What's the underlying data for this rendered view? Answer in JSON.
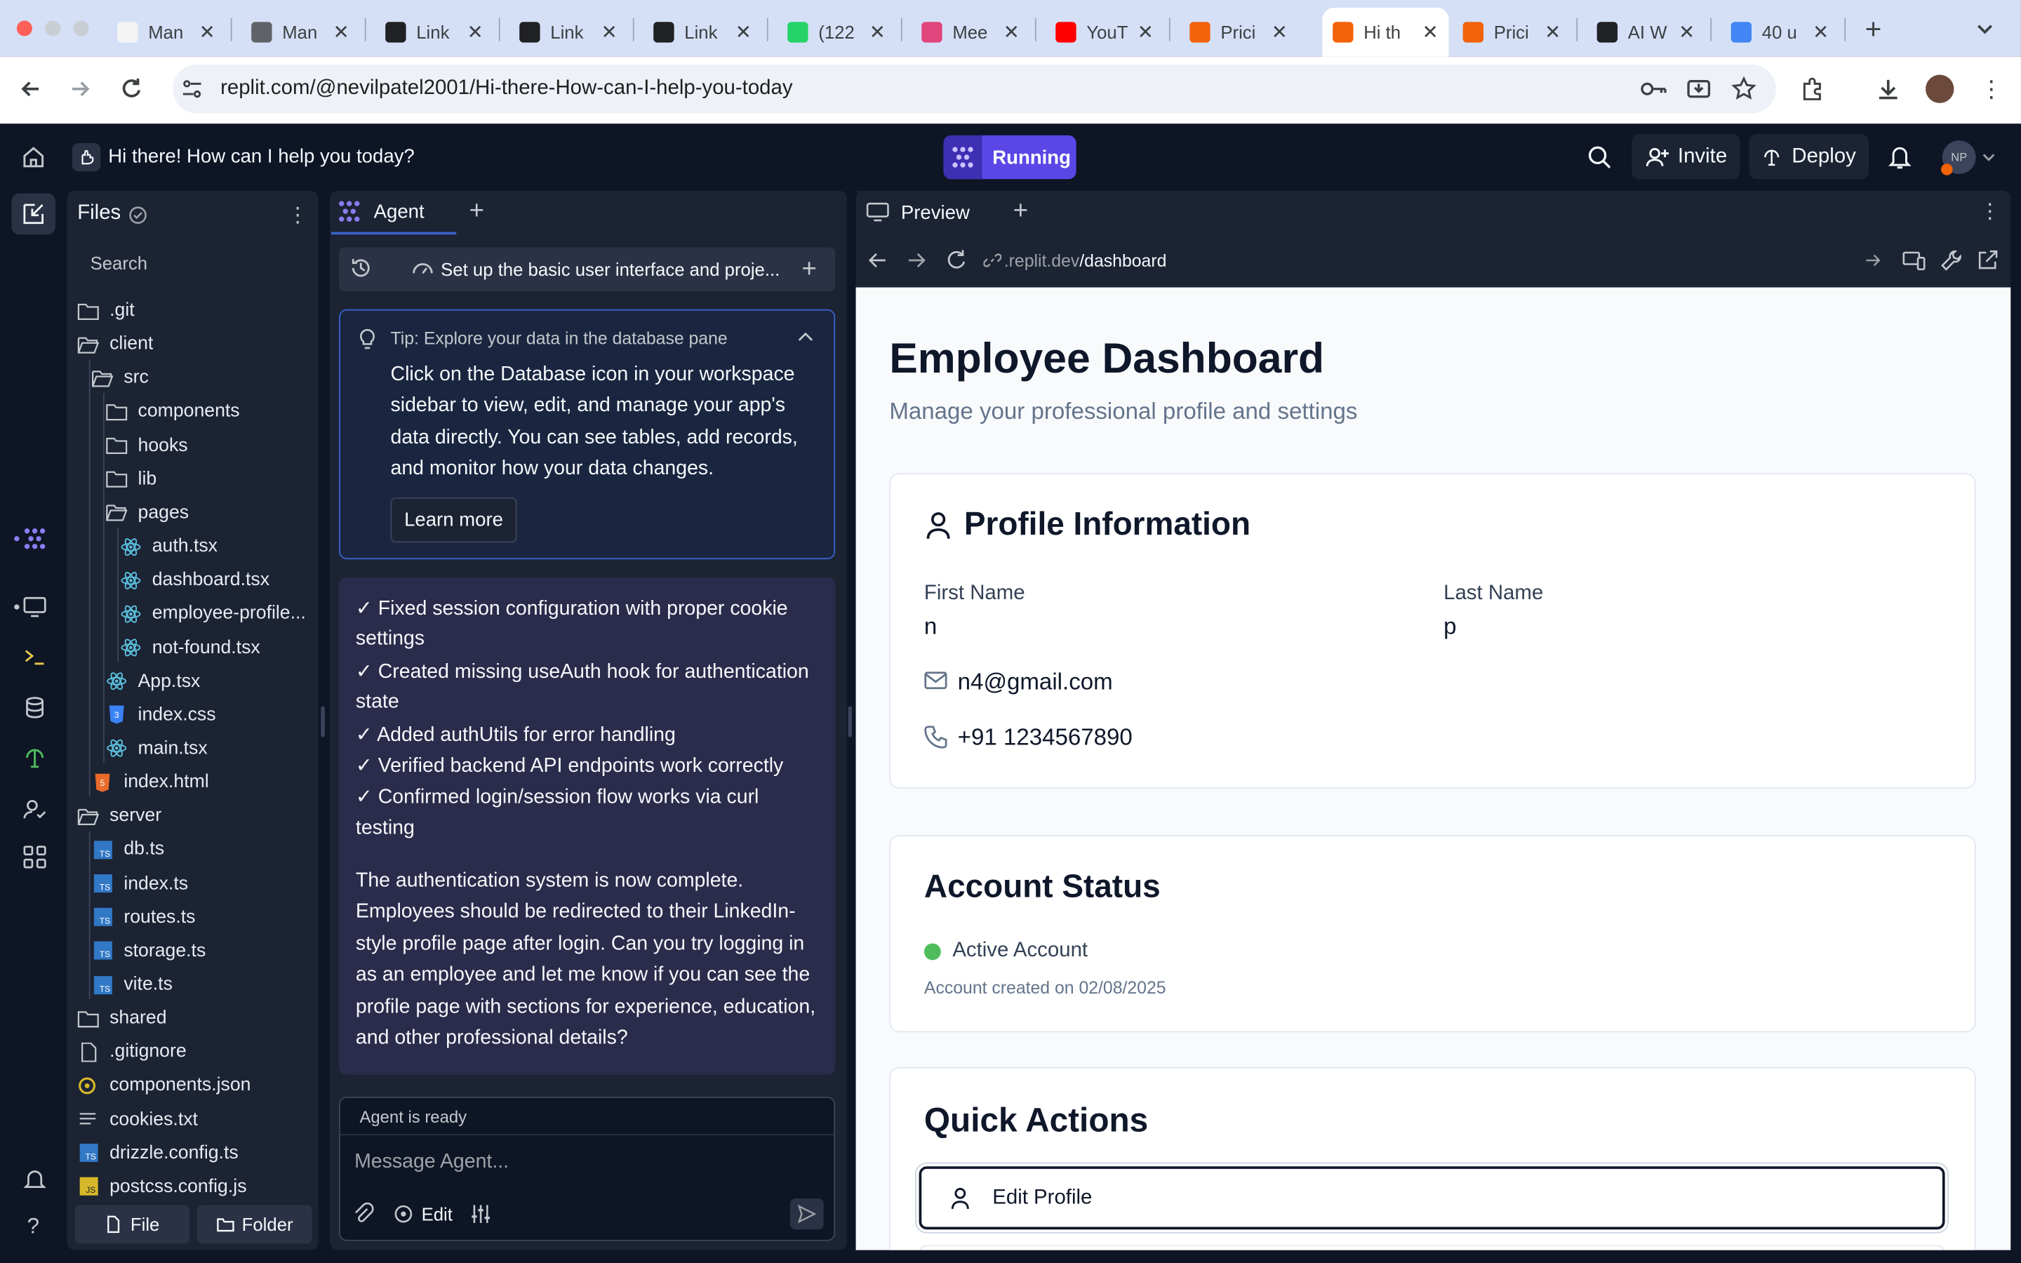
{
  "browser": {
    "tabs": [
      {
        "label": "Man",
        "color": "#f4f4f4"
      },
      {
        "label": "Man",
        "color": "#5f6368"
      },
      {
        "label": "Link",
        "color": "#202124"
      },
      {
        "label": "Link",
        "color": "#202124"
      },
      {
        "label": "Link",
        "color": "#202124"
      },
      {
        "label": "(122",
        "color": "#25d366"
      },
      {
        "label": "Mee",
        "color": "#e0457b"
      },
      {
        "label": "YouT",
        "color": "#ff0000"
      },
      {
        "label": "Prici",
        "color": "#f26207"
      },
      {
        "label": "Hi th",
        "color": "#f26207",
        "active": true
      },
      {
        "label": "Prici",
        "color": "#f26207"
      },
      {
        "label": "AI W",
        "color": "#202124"
      },
      {
        "label": "40 u",
        "color": "#4285f4"
      }
    ],
    "url": "replit.com/@nevilpatel2001/Hi-there-How-can-I-help-you-today"
  },
  "header": {
    "project_title": "Hi there! How can I help you today?",
    "run_status": "Running",
    "invite_label": "Invite",
    "deploy_label": "Deploy",
    "avatar_initials": "NP"
  },
  "files": {
    "title": "Files",
    "search_placeholder": "Search",
    "items": [
      {
        "name": ".git",
        "type": "folder"
      },
      {
        "name": "client",
        "type": "folder-open"
      },
      {
        "name": "src",
        "type": "folder-open"
      },
      {
        "name": "components",
        "type": "folder"
      },
      {
        "name": "hooks",
        "type": "folder"
      },
      {
        "name": "lib",
        "type": "folder"
      },
      {
        "name": "pages",
        "type": "folder-open"
      },
      {
        "name": "auth.tsx",
        "type": "react"
      },
      {
        "name": "dashboard.tsx",
        "type": "react"
      },
      {
        "name": "employee-profile...",
        "type": "react"
      },
      {
        "name": "not-found.tsx",
        "type": "react"
      },
      {
        "name": "App.tsx",
        "type": "react"
      },
      {
        "name": "index.css",
        "type": "css"
      },
      {
        "name": "main.tsx",
        "type": "react"
      },
      {
        "name": "index.html",
        "type": "html"
      },
      {
        "name": "server",
        "type": "folder-open"
      },
      {
        "name": "db.ts",
        "type": "ts"
      },
      {
        "name": "index.ts",
        "type": "ts"
      },
      {
        "name": "routes.ts",
        "type": "ts"
      },
      {
        "name": "storage.ts",
        "type": "ts"
      },
      {
        "name": "vite.ts",
        "type": "ts"
      },
      {
        "name": "shared",
        "type": "folder"
      },
      {
        "name": ".gitignore",
        "type": "file"
      },
      {
        "name": "components.json",
        "type": "json"
      },
      {
        "name": "cookies.txt",
        "type": "text"
      },
      {
        "name": "drizzle.config.ts",
        "type": "ts"
      },
      {
        "name": "postcss.config.js",
        "type": "js"
      }
    ],
    "new_file_label": "File",
    "new_folder_label": "Folder"
  },
  "agent": {
    "tab_label": "Agent",
    "task_title": "Set up the basic user interface and proje...",
    "tip_title": "Tip: Explore your data in the database pane",
    "tip_lines": [
      "Click on the Database icon in your workspace",
      "sidebar to view, edit, and manage your app's",
      "data directly. You can see tables, add records,",
      "and monitor how your data changes."
    ],
    "learn_more": "Learn more",
    "checklist_lines": [
      "✓ Fixed session configuration with proper cookie",
      "settings",
      "✓ Created missing useAuth hook for authentication",
      "state",
      "✓ Added authUtils for error handling",
      "✓ Verified backend API endpoints work correctly",
      "✓ Confirmed login/session flow works via curl",
      "testing"
    ],
    "summary_lines": [
      "The authentication system is now complete.",
      "Employees should be redirected to their LinkedIn-",
      "style profile page after login. Can you try logging in",
      "as an employee and let me know if you can see the",
      "profile page with sections for experience, education,",
      "and other professional details?"
    ],
    "status": "Agent is ready",
    "input_placeholder": "Message Agent...",
    "edit_label": "Edit"
  },
  "preview": {
    "tab_label": "Preview",
    "url_host": ".replit.dev",
    "url_path": "/dashboard",
    "page_title": "Employee Dashboard",
    "page_subtitle": "Manage your professional profile and settings",
    "profile": {
      "heading": "Profile Information",
      "first_name_label": "First Name",
      "first_name": "n",
      "last_name_label": "Last Name",
      "last_name": "p",
      "email": "n4@gmail.com",
      "phone": "+91 1234567890"
    },
    "account": {
      "heading": "Account Status",
      "status": "Active Account",
      "status_color": "#4ebc5a",
      "created": "Account created on 02/08/2025"
    },
    "quick_actions": {
      "heading": "Quick Actions",
      "edit_profile": "Edit Profile"
    }
  }
}
